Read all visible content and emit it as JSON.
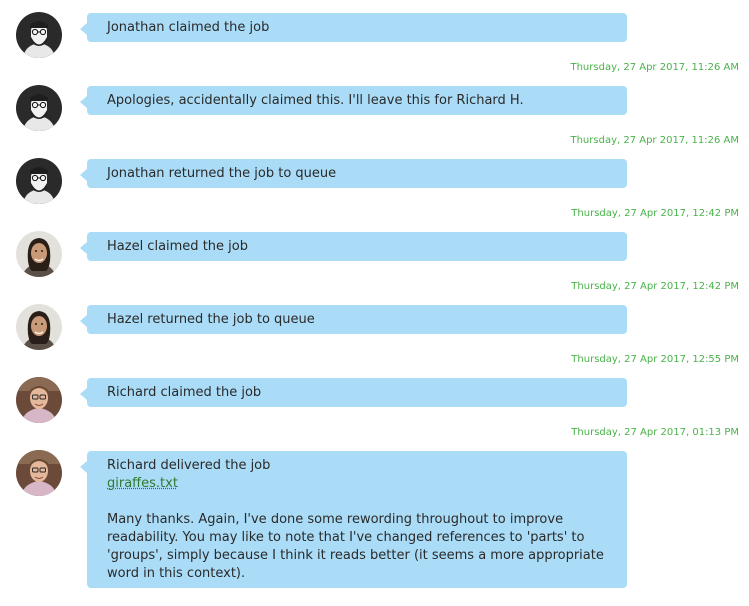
{
  "messages": [
    {
      "author": "Jonathan",
      "text": "Jonathan claimed the job",
      "timestamp": "Thursday, 27 Apr 2017, 11:26 AM"
    },
    {
      "author": "Jonathan",
      "text": "Apologies, accidentally claimed this. I'll leave this for Richard H.",
      "timestamp": "Thursday, 27 Apr 2017, 11:26 AM"
    },
    {
      "author": "Jonathan",
      "text": "Jonathan returned the job to queue",
      "timestamp": "Thursday, 27 Apr 2017, 12:42 PM"
    },
    {
      "author": "Hazel",
      "text": "Hazel claimed the job",
      "timestamp": "Thursday, 27 Apr 2017, 12:42 PM"
    },
    {
      "author": "Hazel",
      "text": "Hazel returned the job to queue",
      "timestamp": "Thursday, 27 Apr 2017, 12:55 PM"
    },
    {
      "author": "Richard",
      "text": "Richard claimed the job",
      "timestamp": "Thursday, 27 Apr 2017, 01:13 PM"
    },
    {
      "author": "Richard",
      "text": "Richard delivered the job",
      "attachment": "giraffes.txt",
      "note": "Many thanks. Again, I've done some rewording throughout to improve readability. You may like to note that I've changed references to 'parts' to 'groups', simply because I think it reads better (it seems a more appropriate word in this context)."
    }
  ],
  "colors": {
    "bubble": "#aadcf7",
    "timestamp": "#49b249",
    "attachment_link": "#2f7a2f"
  }
}
